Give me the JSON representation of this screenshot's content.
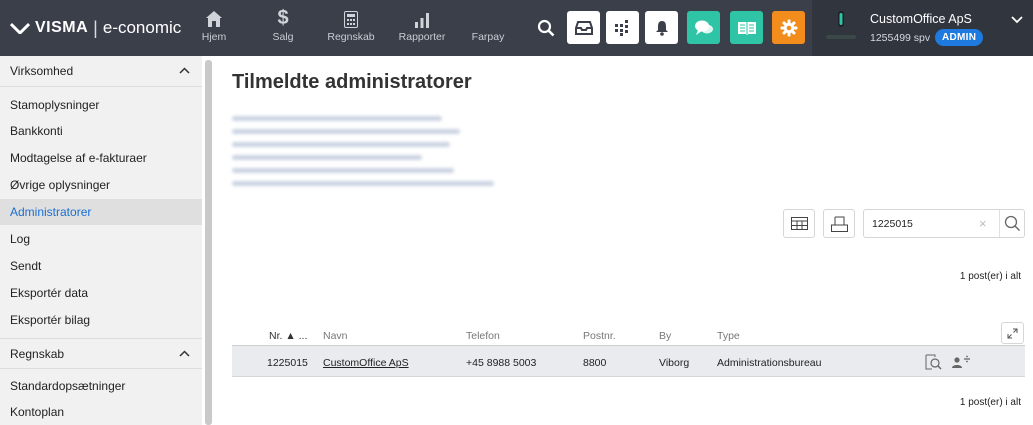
{
  "brand": {
    "name": "VISMA",
    "separator": "|",
    "product": "e-conomic"
  },
  "nav": [
    {
      "label": "Hjem",
      "icon": "home-icon"
    },
    {
      "label": "Salg",
      "icon": "dollar-icon"
    },
    {
      "label": "Regnskab",
      "icon": "calculator-icon"
    },
    {
      "label": "Rapporter",
      "icon": "bar-chart-icon"
    },
    {
      "label": "Farpay",
      "icon": ""
    }
  ],
  "toolbar_icons": [
    "search-icon",
    "inbox-icon",
    "apps-icon",
    "bell-icon",
    "chat-icon",
    "book-icon",
    "gear-icon"
  ],
  "company": {
    "name": "CustomOffice ApS",
    "sub": "1255499 spv",
    "role": "ADMIN"
  },
  "sidebar": {
    "sections": [
      {
        "title": "Virksomhed",
        "items": [
          "Stamoplysninger",
          "Bankkonti",
          "Modtagelse af e-fakturaer",
          "Øvrige oplysninger",
          "Administratorer",
          "Log",
          "Sendt",
          "Eksportér data",
          "Eksportér bilag"
        ],
        "active_index": 4
      },
      {
        "title": "Regnskab",
        "items": [
          "Standardopsætninger",
          "Kontoplan"
        ]
      }
    ]
  },
  "page": {
    "title": "Tilmeldte administratorer"
  },
  "search": {
    "value": "1225015",
    "clear": "×"
  },
  "result_count": "1 post(er) i alt",
  "table": {
    "headers": [
      "Nr. ▲ ...",
      "Navn",
      "Telefon",
      "Postnr.",
      "By",
      "Type"
    ],
    "rows": [
      [
        "1225015",
        "CustomOffice ApS",
        "+45 8988 5003",
        "8800",
        "Viborg",
        "Administrationsbureau"
      ]
    ]
  },
  "colors": {
    "topbar": "#3a3f4a",
    "accent_blue": "#1f7ae0",
    "teal": "#2ec4a5",
    "orange": "#f28c1c",
    "active_link": "#1a6fd1"
  }
}
